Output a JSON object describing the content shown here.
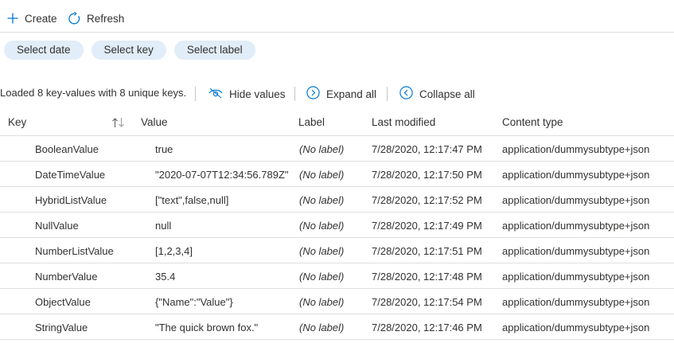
{
  "toolbar": {
    "create_label": "Create",
    "refresh_label": "Refresh"
  },
  "filters": {
    "select_date": "Select date",
    "select_key": "Select key",
    "select_label": "Select label"
  },
  "status": {
    "loaded_text": "Loaded 8 key-values with 8 unique keys."
  },
  "actions": {
    "hide_values": "Hide values",
    "expand_all": "Expand all",
    "collapse_all": "Collapse all"
  },
  "table": {
    "columns": {
      "key": "Key",
      "value": "Value",
      "label": "Label",
      "last_modified": "Last modified",
      "content_type": "Content type"
    },
    "rows": [
      {
        "key": "BooleanValue",
        "value": "true",
        "label": "(No label)",
        "modified": "7/28/2020, 12:17:47 PM",
        "content_type": "application/dummysubtype+json"
      },
      {
        "key": "DateTimeValue",
        "value": "\"2020-07-07T12:34:56.789Z\"",
        "label": "(No label)",
        "modified": "7/28/2020, 12:17:50 PM",
        "content_type": "application/dummysubtype+json"
      },
      {
        "key": "HybridListValue",
        "value": "[\"text\",false,null]",
        "label": "(No label)",
        "modified": "7/28/2020, 12:17:52 PM",
        "content_type": "application/dummysubtype+json"
      },
      {
        "key": "NullValue",
        "value": "null",
        "label": "(No label)",
        "modified": "7/28/2020, 12:17:49 PM",
        "content_type": "application/dummysubtype+json"
      },
      {
        "key": "NumberListValue",
        "value": "[1,2,3,4]",
        "label": "(No label)",
        "modified": "7/28/2020, 12:17:51 PM",
        "content_type": "application/dummysubtype+json"
      },
      {
        "key": "NumberValue",
        "value": "35.4",
        "label": "(No label)",
        "modified": "7/28/2020, 12:17:48 PM",
        "content_type": "application/dummysubtype+json"
      },
      {
        "key": "ObjectValue",
        "value": "{\"Name\":\"Value\"}",
        "label": "(No label)",
        "modified": "7/28/2020, 12:17:54 PM",
        "content_type": "application/dummysubtype+json"
      },
      {
        "key": "StringValue",
        "value": "\"The quick brown fox.\"",
        "label": "(No label)",
        "modified": "7/28/2020, 12:17:46 PM",
        "content_type": "application/dummysubtype+json"
      }
    ]
  },
  "icons": {
    "create": "plus-icon",
    "refresh": "refresh-icon",
    "hide_values": "eye-icon",
    "expand_all": "chevron-right-circle-icon",
    "collapse_all": "chevron-left-circle-icon",
    "sort": "sort-arrows-icon"
  },
  "colors": {
    "accent": "#0078d4",
    "pill_background": "#e1edf8"
  }
}
